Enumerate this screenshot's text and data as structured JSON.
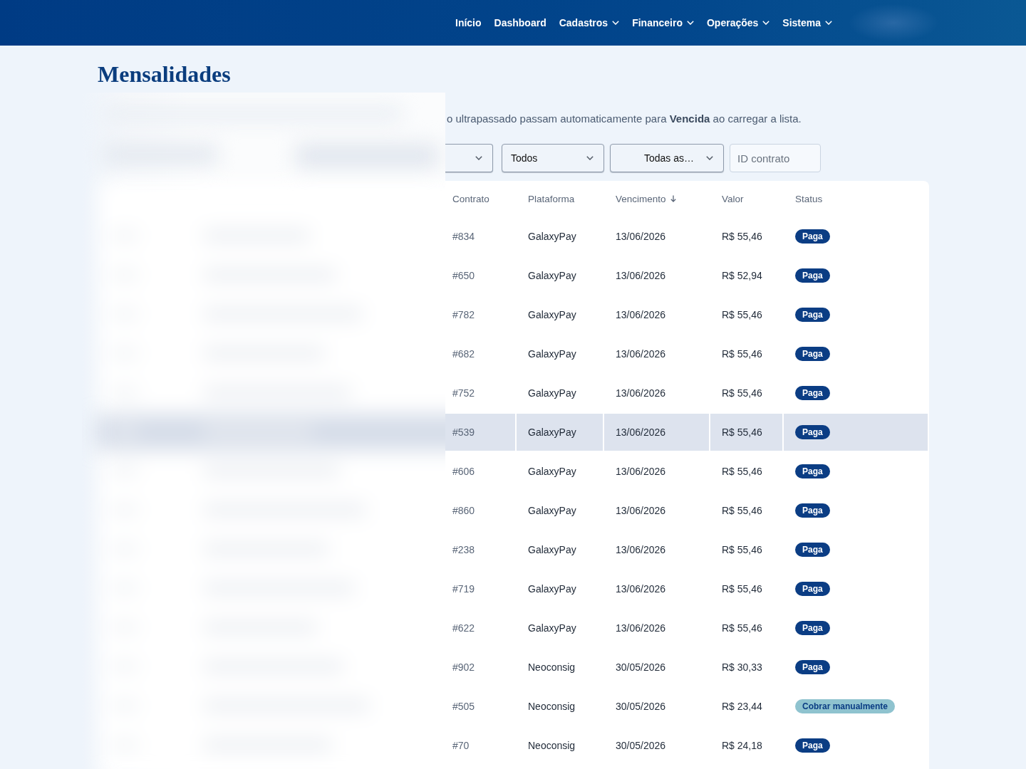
{
  "nav": {
    "items": [
      {
        "label": "Início",
        "has_menu": false
      },
      {
        "label": "Dashboard",
        "has_menu": false
      },
      {
        "label": "Cadastros",
        "has_menu": true
      },
      {
        "label": "Financeiro",
        "has_menu": true
      },
      {
        "label": "Operações",
        "has_menu": true
      },
      {
        "label": "Sistema",
        "has_menu": true
      }
    ]
  },
  "page": {
    "title": "Mensalidades",
    "description": "o ultrapassado passam automaticamente para **Vencida** ao carregar a lista."
  },
  "filters": [
    {
      "kind": "select"
    },
    {
      "kind": "select",
      "value": "Todos"
    },
    {
      "kind": "select",
      "value": "Todas as…"
    },
    {
      "kind": "input",
      "placeholder": "ID contrato"
    }
  ],
  "table": {
    "columns": [
      {
        "label": "Contrato",
        "sorted": false
      },
      {
        "label": "Plataforma",
        "sorted": false
      },
      {
        "label": "Vencimento",
        "sorted": true
      },
      {
        "label": "Valor",
        "sorted": false
      },
      {
        "label": "Status",
        "sorted": false
      }
    ],
    "rows": [
      {
        "contract": "#834",
        "platform": "GalaxyPay",
        "due_date": "13/06/2026",
        "amount": "R$ 55,46",
        "status": {
          "label": "Paga",
          "color": "#0b3d84"
        },
        "selected": false
      },
      {
        "contract": "#650",
        "platform": "GalaxyPay",
        "due_date": "13/06/2026",
        "amount": "R$ 52,94",
        "status": {
          "label": "Paga",
          "color": "#0b3d84"
        },
        "selected": false
      },
      {
        "contract": "#782",
        "platform": "GalaxyPay",
        "due_date": "13/06/2026",
        "amount": "R$ 55,46",
        "status": {
          "label": "Paga",
          "color": "#0b3d84"
        },
        "selected": false
      },
      {
        "contract": "#682",
        "platform": "GalaxyPay",
        "due_date": "13/06/2026",
        "amount": "R$ 55,46",
        "status": {
          "label": "Paga",
          "color": "#0b3d84"
        },
        "selected": false
      },
      {
        "contract": "#752",
        "platform": "GalaxyPay",
        "due_date": "13/06/2026",
        "amount": "R$ 55,46",
        "status": {
          "label": "Paga",
          "color": "#0b3d84"
        },
        "selected": false
      },
      {
        "contract": "#539",
        "platform": "GalaxyPay",
        "due_date": "13/06/2026",
        "amount": "R$ 55,46",
        "status": {
          "label": "Paga",
          "color": "#0b3d84"
        },
        "selected": true
      },
      {
        "contract": "#606",
        "platform": "GalaxyPay",
        "due_date": "13/06/2026",
        "amount": "R$ 55,46",
        "status": {
          "label": "Paga",
          "color": "#0b3d84"
        },
        "selected": false
      },
      {
        "contract": "#860",
        "platform": "GalaxyPay",
        "due_date": "13/06/2026",
        "amount": "R$ 55,46",
        "status": {
          "label": "Paga",
          "color": "#0b3d84"
        },
        "selected": false
      },
      {
        "contract": "#238",
        "platform": "GalaxyPay",
        "due_date": "13/06/2026",
        "amount": "R$ 55,46",
        "status": {
          "label": "Paga",
          "color": "#0b3d84"
        },
        "selected": false
      },
      {
        "contract": "#719",
        "platform": "GalaxyPay",
        "due_date": "13/06/2026",
        "amount": "R$ 55,46",
        "status": {
          "label": "Paga",
          "color": "#0b3d84"
        },
        "selected": false
      },
      {
        "contract": "#622",
        "platform": "GalaxyPay",
        "due_date": "13/06/2026",
        "amount": "R$ 55,46",
        "status": {
          "label": "Paga",
          "color": "#0b3d84"
        },
        "selected": false
      },
      {
        "contract": "#902",
        "platform": "Neoconsig",
        "due_date": "30/05/2026",
        "amount": "R$ 30,33",
        "status": {
          "label": "Paga",
          "color": "#0b3d84"
        },
        "selected": false
      },
      {
        "contract": "#505",
        "platform": "Neoconsig",
        "due_date": "30/05/2026",
        "amount": "R$ 23,44",
        "status": {
          "label": "Cobrar manualmente",
          "color": "#8fc3cf"
        },
        "selected": false
      },
      {
        "contract": "#70",
        "platform": "Neoconsig",
        "due_date": "30/05/2026",
        "amount": "R$ 24,18",
        "status": {
          "label": "Paga",
          "color": "#0b3d84"
        },
        "selected": false
      }
    ]
  }
}
